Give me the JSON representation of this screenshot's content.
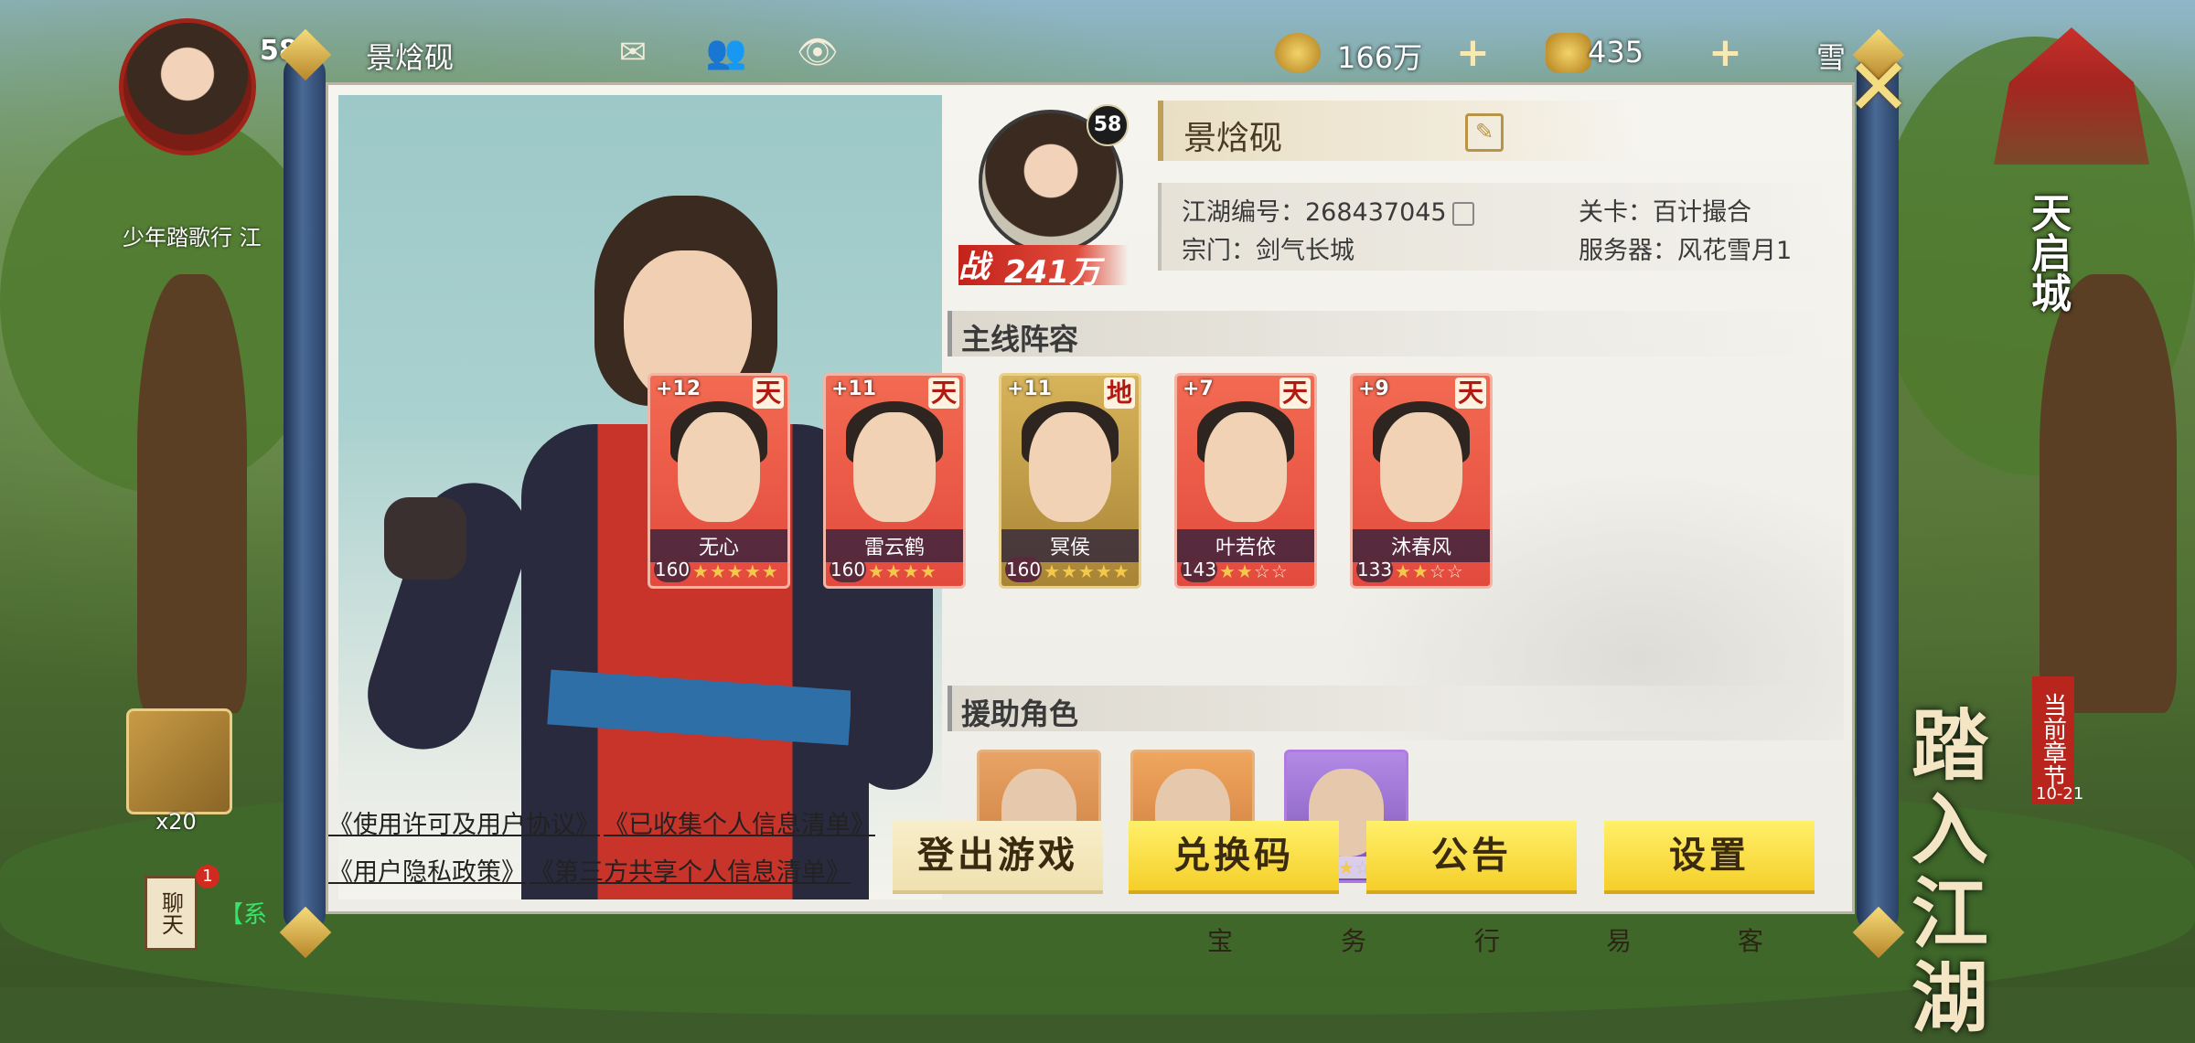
{
  "hud": {
    "player_level": "58",
    "player_name": "景焓砚",
    "gold": "166万",
    "ingot": "435",
    "snow_label": "雪"
  },
  "left": {
    "game_title_label": "少年踏歌行 江",
    "item_count": "x20",
    "chat_label": "聊天",
    "chat_badge": "1",
    "system_prefix": "【系"
  },
  "right": {
    "city_name": "天启城",
    "chapter_tag": "当前章节",
    "chapter_num": "10-21",
    "chapter_title": "踏入江湖"
  },
  "bottom_menu": [
    "宝",
    "务",
    "行",
    "易",
    "客"
  ],
  "profile": {
    "name": "景焓砚",
    "level": "58",
    "power_icon": "战",
    "power": "241万",
    "id_label": "江湖编号：",
    "id_value": "268437045",
    "sect_label": "宗门：",
    "sect_value": "剑气长城",
    "stage_label": "关卡：",
    "stage_value": "百计撮合",
    "server_label": "服务器：",
    "server_value": "风花雪月1"
  },
  "lineup_title": "主线阵容",
  "lineup": [
    {
      "name": "无心",
      "plus": "+12",
      "tier": "天",
      "level": "160",
      "stars": 5,
      "filled": 5,
      "gold": false
    },
    {
      "name": "雷云鹤",
      "plus": "+11",
      "tier": "天",
      "level": "160",
      "stars": 4,
      "filled": 4,
      "gold": false
    },
    {
      "name": "冥侯",
      "plus": "+11",
      "tier": "地",
      "level": "160",
      "stars": 5,
      "filled": 5,
      "gold": true
    },
    {
      "name": "叶若依",
      "plus": "+7",
      "tier": "天",
      "level": "143",
      "stars": 4,
      "filled": 2,
      "gold": false
    },
    {
      "name": "沐春风",
      "plus": "+9",
      "tier": "天",
      "level": "133",
      "stars": 4,
      "filled": 2,
      "gold": false
    }
  ],
  "support_title": "援助角色",
  "support": [
    {
      "stars": 5,
      "filled": 1,
      "style": "orange"
    },
    {
      "stars": 0,
      "filled": 0,
      "style": "orange2"
    },
    {
      "stars": 5,
      "filled": 3,
      "style": "purple"
    }
  ],
  "links": {
    "l1": "《使用许可及用户协议》",
    "l2": "《已收集个人信息清单》",
    "l3": "《用户隐私政策》",
    "l4": "《第三方共享个人信息清单》"
  },
  "buttons": {
    "logout": "登出游戏",
    "redeem": "兑换码",
    "notice": "公告",
    "settings": "设置"
  },
  "icons": {
    "close": "close-icon",
    "edit": "edit-icon",
    "copy": "copy-icon",
    "mail": "mail-icon",
    "friends": "friends-icon",
    "eye": "eye-icon"
  }
}
